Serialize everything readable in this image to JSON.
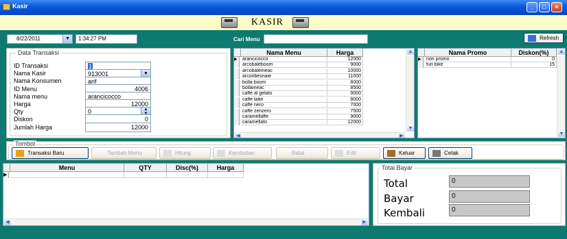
{
  "window": {
    "title": "Kasir"
  },
  "header": {
    "title": "KASIR"
  },
  "toolbar": {
    "date": "8/22/2011",
    "time": "1:34:27 PM",
    "search_label": "Cari Menu",
    "search_value": "",
    "refresh_label": "Refresh"
  },
  "data_transaksi": {
    "legend": "Data Transaksi",
    "fields": [
      {
        "label": "ID Transaksi",
        "value": "1"
      },
      {
        "label": "Nama Kasir",
        "value": "913001"
      },
      {
        "label": "Nama Konsumen",
        "value": "arif"
      },
      {
        "label": "ID Menu",
        "value": "4006"
      },
      {
        "label": "Nama menu",
        "value": "arancicocco"
      },
      {
        "label": "Harga",
        "value": "12000"
      },
      {
        "label": "Qty",
        "value": "0"
      },
      {
        "label": "Diskon",
        "value": "0"
      },
      {
        "label": "Jumlah Harga",
        "value": "12000"
      }
    ]
  },
  "menu_grid": {
    "headers": [
      "Nama Menu",
      "Harga"
    ],
    "rows": [
      [
        "arancicocco",
        "12000"
      ],
      [
        "arcobaleboom",
        "9000"
      ],
      [
        "arcobalemeac",
        "10000"
      ],
      [
        "arcoribesnaie",
        "11000"
      ],
      [
        "bolla boom",
        "8000"
      ],
      [
        "bollameac",
        "8500"
      ],
      [
        "caffe al gelato",
        "9000"
      ],
      [
        "caffe latte",
        "8000"
      ],
      [
        "caffe nero",
        "7000"
      ],
      [
        "caffe zenzero",
        "7500"
      ],
      [
        "caramellaffe",
        "9000"
      ],
      [
        "caramellato",
        "12000"
      ]
    ]
  },
  "promo_grid": {
    "headers": [
      "Nama Promo",
      "Diskon(%)"
    ],
    "rows": [
      [
        "non promo",
        "0"
      ],
      [
        "fun bike",
        "15"
      ]
    ]
  },
  "tombol": {
    "legend": "Tombol",
    "buttons": [
      "Transaksi Baru",
      "Tambah Menu",
      "Hitung",
      "Kembalian",
      "Batal",
      "Edit",
      "Keluar",
      "Cetak"
    ]
  },
  "order_grid": {
    "headers": [
      "Menu",
      "QTY",
      "Disc(%)",
      "Harga"
    ]
  },
  "total_bayar": {
    "legend": "Total Bayar",
    "total_label": "Total",
    "total_value": "0",
    "bayar_label": "Bayar",
    "bayar_value": "0",
    "kembali_label": "Kembali",
    "kembali_value": "0"
  }
}
